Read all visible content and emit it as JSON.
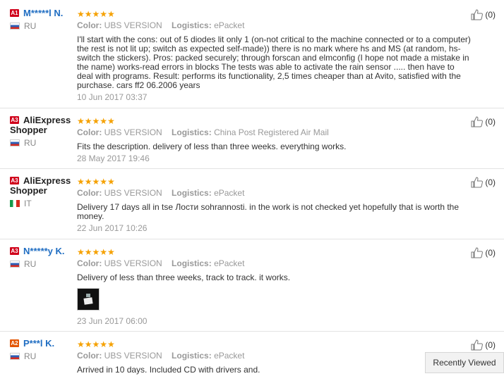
{
  "reviews": [
    {
      "level": "A1",
      "username": "M*****l N.",
      "country": "RU",
      "stars": "★★★★★",
      "color_label": "Color:",
      "color_value": "UBS VERSION",
      "logistics_label": "Logistics:",
      "logistics_value": "ePacket",
      "text": "I'll start with the cons: out of 5 diodes lit only 1 (on-not critical to the machine connected or to a computer) the rest is not lit up; switch as expected self-made)) there is no mark where hs and MS (at random, hs-switch the stickers). Pros: packed securely; through forscan and elmconfig (I hope not made a mistake in the name) works-read errors in blocks The tests was able to activate the rain sensor ..... then have to deal with programs. Result: performs its functionality, 2,5 times cheaper than at Avito, satisfied with the purchase. cars ff2 06.2006 years",
      "date": "10 Jun 2017 03:37",
      "likes": "(0)"
    },
    {
      "level": "A3",
      "username": "AliExpress Shopper",
      "country": "RU",
      "stars": "★★★★★",
      "color_label": "Color:",
      "color_value": "UBS VERSION",
      "logistics_label": "Logistics:",
      "logistics_value": "China Post Registered Air Mail",
      "text": "Fits the description. delivery of less than three weeks. everything works.",
      "date": "28 May 2017 19:46",
      "likes": "(0)"
    },
    {
      "level": "A3",
      "username": "AliExpress Shopper",
      "country": "IT",
      "stars": "★★★★★",
      "color_label": "Color:",
      "color_value": "UBS VERSION",
      "logistics_label": "Logistics:",
      "logistics_value": "ePacket",
      "text": "Delivery 17 days all in tse Лости sohrannosti. in the work is not checked yet hopefully that is worth the money.",
      "date": "22 Jun 2017 10:26",
      "likes": "(0)"
    },
    {
      "level": "A3",
      "username": "N*****y K.",
      "country": "RU",
      "stars": "★★★★★",
      "color_label": "Color:",
      "color_value": "UBS VERSION",
      "logistics_label": "Logistics:",
      "logistics_value": "ePacket",
      "text": "Delivery of less than three weeks, track to track. it works.",
      "date": "23 Jun 2017 06:00",
      "likes": "(0)"
    },
    {
      "level": "A2",
      "username": "P***l K.",
      "country": "RU",
      "stars": "★★★★★",
      "color_label": "Color:",
      "color_value": "UBS VERSION",
      "logistics_label": "Logistics:",
      "logistics_value": "ePacket",
      "text": "Arrived in 10 days. Included CD with drivers and.",
      "date": "",
      "likes": "(0)"
    }
  ],
  "recently_viewed": "Recently Viewed",
  "icons": {
    "like": "thumbs-up-icon",
    "photo": "review-photo"
  }
}
